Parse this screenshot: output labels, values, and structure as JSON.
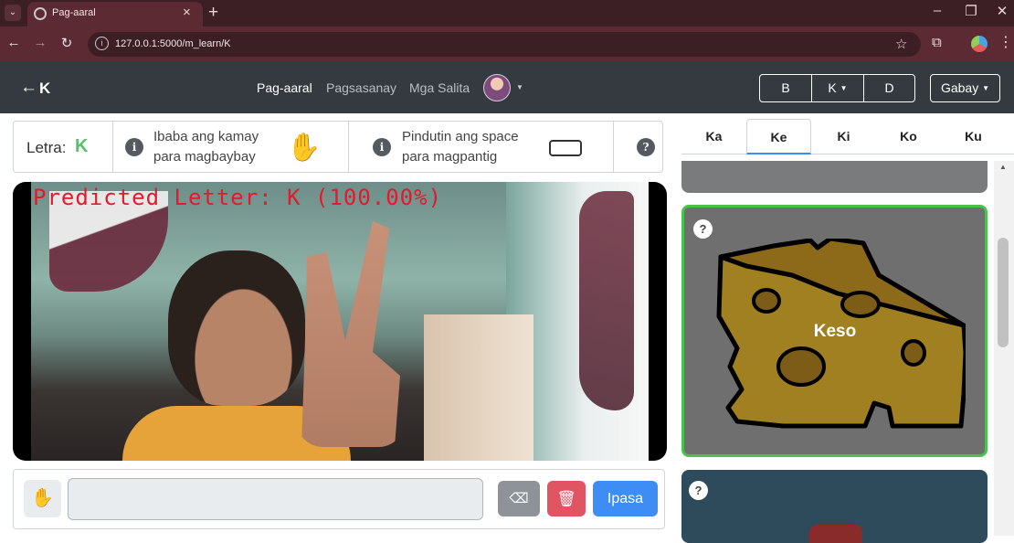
{
  "browser": {
    "tab_title": "Pag-aaral",
    "url": "127.0.0.1:5000/m_learn/K",
    "icons": [
      "tab-list-icon",
      "globe-icon",
      "close-icon",
      "plus-icon",
      "minimize-icon",
      "restore-icon",
      "close-window-icon",
      "back-icon",
      "forward-icon",
      "reload-icon",
      "site-info-icon",
      "star-icon",
      "extensions-icon",
      "profile-icon",
      "menu-icon"
    ]
  },
  "navbar": {
    "back_arrow": "←",
    "letter": "K",
    "links": [
      "Pag-aaral",
      "Pagsasanay",
      "Mga Salita"
    ],
    "active_link": "Pag-aaral",
    "letter_buttons": [
      "B",
      "K",
      "D"
    ],
    "guide_button": "Gabay"
  },
  "info_strip": {
    "letter_label": "Letra:",
    "letter_value": "K",
    "instruction_1_line1": "Ibaba ang kamay",
    "instruction_1_line2": "para magbaybay",
    "instruction_2_line1": "Pindutin ang space",
    "instruction_2_line2": "para magpantig",
    "info_glyph": "i",
    "help_glyph": "?"
  },
  "camera": {
    "prediction_text": "Predicted Letter: K (100.00%)"
  },
  "input_row": {
    "text_value": "",
    "submit_label": "Ipasa"
  },
  "sidebar": {
    "syllable_tabs": [
      "Ka",
      "Ke",
      "Ki",
      "Ko",
      "Ku"
    ],
    "active_tab": "Ke",
    "card_word": "Keso",
    "help_glyph": "?"
  },
  "colors": {
    "accent_green": "#55c26a",
    "card_border_green": "#4cc24e",
    "primary_blue": "#3d8df5",
    "danger_red": "#e15562",
    "navbar_dark": "#343a40",
    "prediction_red": "#e11b2b"
  }
}
